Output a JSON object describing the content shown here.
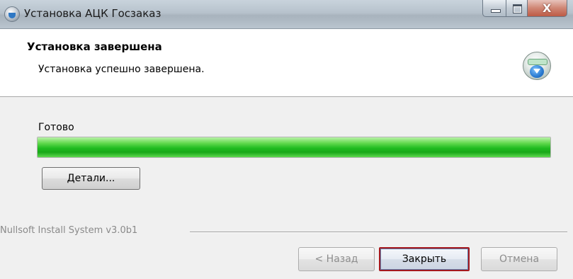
{
  "window": {
    "title": "Установка АЦК Госзаказ",
    "controls": {
      "minimize_icon": "minimize-icon",
      "maximize_icon": "maximize-icon",
      "close_icon": "close-icon",
      "close_glyph": "X"
    }
  },
  "header": {
    "title": "Установка завершена",
    "subtitle": "Установка успешно завершена.",
    "icon": "installer-globe-icon"
  },
  "body": {
    "status": "Готово",
    "progress": 1.0,
    "progress_color": "#1fbb1f",
    "details_button": "Детали..."
  },
  "footer": {
    "brand": "Nullsoft Install System v3.0b1",
    "buttons": {
      "back": "< Назад",
      "close": "Закрыть",
      "cancel": "Отмена"
    },
    "highlight_color": "#a6191e"
  }
}
